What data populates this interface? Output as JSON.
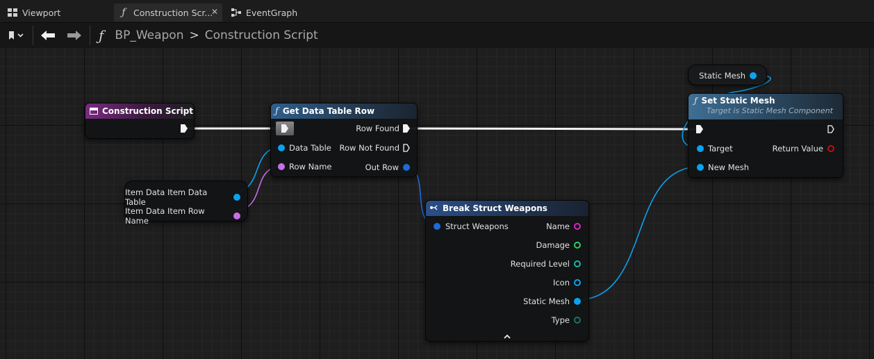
{
  "tabs": [
    {
      "label": "Viewport",
      "icon": "viewport-icon"
    },
    {
      "label": "Construction Scr...",
      "icon": "function-icon",
      "active": true
    },
    {
      "label": "EventGraph",
      "icon": "event-graph-icon"
    }
  ],
  "breadcrumb": {
    "blueprint": "BP_Weapon",
    "separator": ">",
    "graph": "Construction Script"
  },
  "nodes": {
    "construction_script": {
      "title": "Construction Script"
    },
    "get_data_table_row": {
      "title": "Get Data Table Row",
      "pins": {
        "data_table": "Data Table",
        "row_name": "Row Name",
        "row_found": "Row Found",
        "row_not_found": "Row Not Found",
        "out_row": "Out Row"
      }
    },
    "item_data": {
      "table": "Item Data Item Data Table",
      "row_name": "Item Data Item Row Name"
    },
    "break_struct": {
      "title": "Break Struct Weapons",
      "input": "Struct Weapons",
      "outputs": [
        "Name",
        "Damage",
        "Required Level",
        "Icon",
        "Static Mesh",
        "Type"
      ]
    },
    "static_mesh_var": {
      "label": "Static Mesh"
    },
    "set_static_mesh": {
      "title": "Set Static Mesh",
      "subtitle": "Target is Static Mesh Component",
      "pins": {
        "target": "Target",
        "new_mesh": "New Mesh",
        "return_value": "Return Value"
      }
    }
  },
  "colors": {
    "function_header": "#2e5f8c",
    "event_header": "#7b2a82",
    "object_pin": "#0aa2f0",
    "name_pin": "#c76ee8",
    "struct_pin": "#1d6ad9",
    "string_pin": "#e020c8",
    "float_pin": "#29d060",
    "enum_pin": "#1ab8a0"
  }
}
